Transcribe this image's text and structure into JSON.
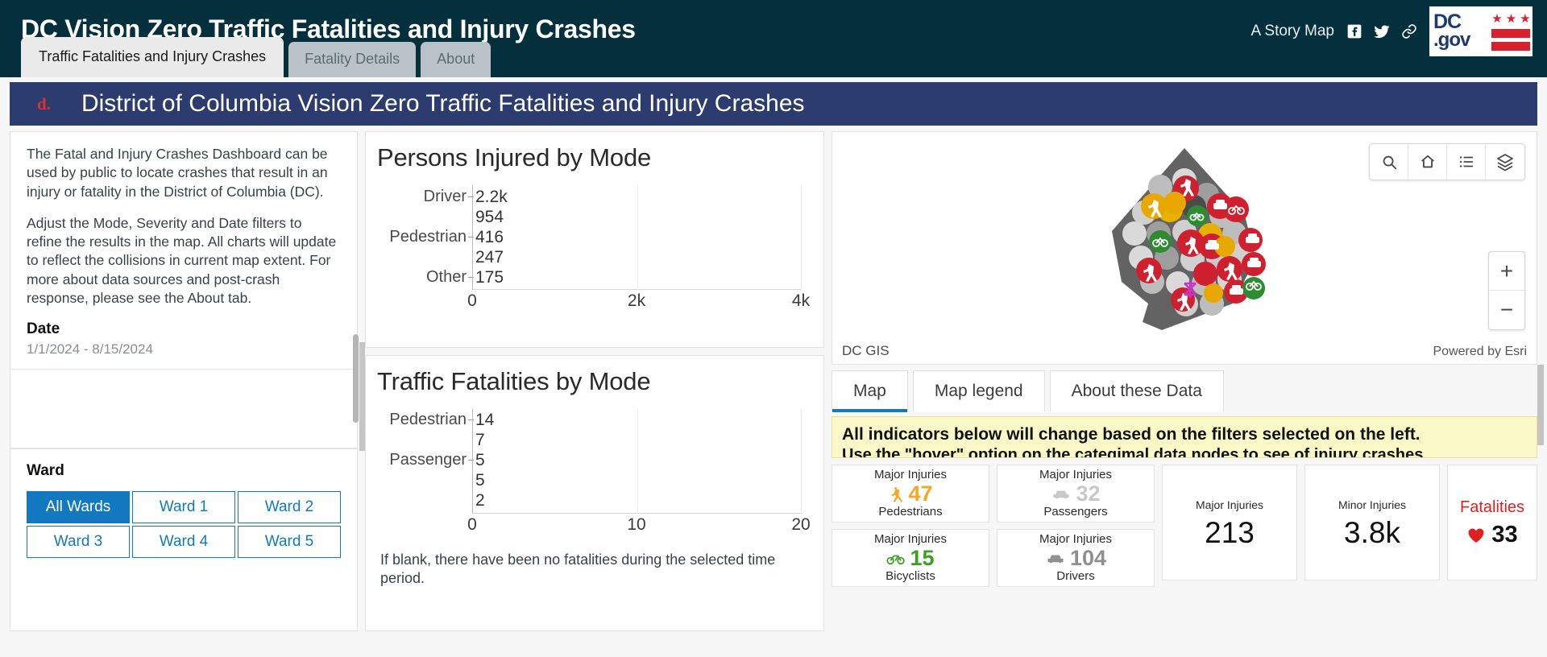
{
  "header": {
    "title": "DC Vision Zero Traffic Fatalities and Injury Crashes",
    "story_map_label": "A Story Map",
    "social": [
      {
        "name": "facebook-icon",
        "glyph": "f"
      },
      {
        "name": "twitter-icon",
        "glyph": "t"
      },
      {
        "name": "link-icon",
        "glyph": "link"
      }
    ],
    "logo": {
      "dc": "DC",
      "gov": ".gov"
    },
    "tabs": [
      {
        "label": "Traffic Fatalities and Injury Crashes",
        "active": true
      },
      {
        "label": "Fatality Details",
        "active": false
      },
      {
        "label": "About",
        "active": false
      }
    ]
  },
  "banner": {
    "logo_text": "d.",
    "title": "District of Columbia Vision Zero Traffic Fatalities and Injury Crashes",
    "bg_color": "#2c3c6e"
  },
  "sidebar": {
    "paragraphs": [
      "The Fatal and Injury Crashes Dashboard can be used by public to locate crashes that result in an injury or fatality in the District of Columbia (DC).",
      "Adjust the Mode, Severity and Date filters to refine the results in the map. All charts will update to reflect the collisions in current map extent. For more about data sources and post-crash response, please see the About tab."
    ],
    "date_filter": {
      "label": "Date",
      "value": "1/1/2024 - 8/15/2024"
    },
    "ward_filter": {
      "label": "Ward",
      "options": [
        {
          "label": "All Wards",
          "selected": true
        },
        {
          "label": "Ward 1",
          "selected": false
        },
        {
          "label": "Ward 2",
          "selected": false
        },
        {
          "label": "Ward 3",
          "selected": false
        },
        {
          "label": "Ward 4",
          "selected": false
        },
        {
          "label": "Ward 5",
          "selected": false
        }
      ]
    }
  },
  "chart_data": [
    {
      "type": "bar",
      "orientation": "horizontal",
      "title": "Persons Injured by Mode",
      "categories": [
        "Driver",
        "",
        "Pedestrian",
        "",
        "Other"
      ],
      "tick_labels": [
        "Driver",
        "Pedestrian",
        "Other"
      ],
      "values": [
        2200,
        954,
        416,
        247,
        175
      ],
      "value_labels": [
        "2.2k",
        "954",
        "416",
        "247",
        "175"
      ],
      "colors": [
        "#8f8f8f",
        "#c6c6c6",
        "#3aa01e",
        "#f5a800",
        "#0a84e6"
      ],
      "xlabel": "",
      "ylabel": "",
      "xlim": [
        0,
        4000
      ],
      "xticks": [
        0,
        2000,
        4000
      ],
      "xtick_labels": [
        "0",
        "2k",
        "4k"
      ],
      "grid": true
    },
    {
      "type": "bar",
      "orientation": "horizontal",
      "title": "Traffic Fatalities by Mode",
      "categories": [
        "Pedestrian",
        "",
        "Passenger",
        "",
        ""
      ],
      "tick_labels": [
        "Pedestrian",
        "Passenger"
      ],
      "values": [
        14,
        7,
        5,
        5,
        2
      ],
      "value_labels": [
        "14",
        "7",
        "5",
        "5",
        "2"
      ],
      "colors": [
        "#f41d1d",
        "#f41d1d",
        "#f41d1d",
        "#f41d1d",
        "#f41d1d"
      ],
      "xlabel": "",
      "ylabel": "",
      "xlim": [
        0,
        20
      ],
      "xticks": [
        0,
        10,
        20
      ],
      "xtick_labels": [
        "0",
        "10",
        "20"
      ],
      "grid": true,
      "note": "If blank, there have been no fatalities during the selected time period."
    }
  ],
  "map": {
    "credit_left": "DC GIS",
    "credit_right": "Powered by Esri",
    "tools": [
      {
        "name": "search-icon"
      },
      {
        "name": "home-icon"
      },
      {
        "name": "legend-list-icon"
      },
      {
        "name": "layers-icon"
      }
    ],
    "zoom_in": "+",
    "zoom_out": "−",
    "tabs": [
      {
        "label": "Map",
        "active": true
      },
      {
        "label": "Map legend",
        "active": false
      },
      {
        "label": "About these Data",
        "active": false
      }
    ]
  },
  "notice": {
    "line1": "All indicators below will change based on the filters selected on the left.",
    "line2": "Use the \"hover\" option on the categimal data nodes to see of injury crashes"
  },
  "indicators": {
    "mini_cards": [
      {
        "label": "Major Injuries",
        "value": "47",
        "sublabel": "Pedestrians",
        "color": "#f5a623",
        "icon": "pedestrian-icon"
      },
      {
        "label": "Major Injuries",
        "value": "32",
        "sublabel": "Passengers",
        "color": "#c8c8c8",
        "icon": "passenger-car-icon"
      },
      {
        "label": "Major Injuries",
        "value": "15",
        "sublabel": "Bicyclists",
        "color": "#3aa01e",
        "icon": "bicycle-icon"
      },
      {
        "label": "Major Injuries",
        "value": "104",
        "sublabel": "Drivers",
        "color": "#8f8f8f",
        "icon": "car-icon"
      }
    ],
    "major_injuries": {
      "label": "Major Injuries",
      "value": "213"
    },
    "minor_injuries": {
      "label": "Minor Injuries",
      "value": "3.8k"
    },
    "fatalities": {
      "label": "Fatalities",
      "value": "33",
      "icon": "heart-icon",
      "color": "#e02020"
    }
  }
}
